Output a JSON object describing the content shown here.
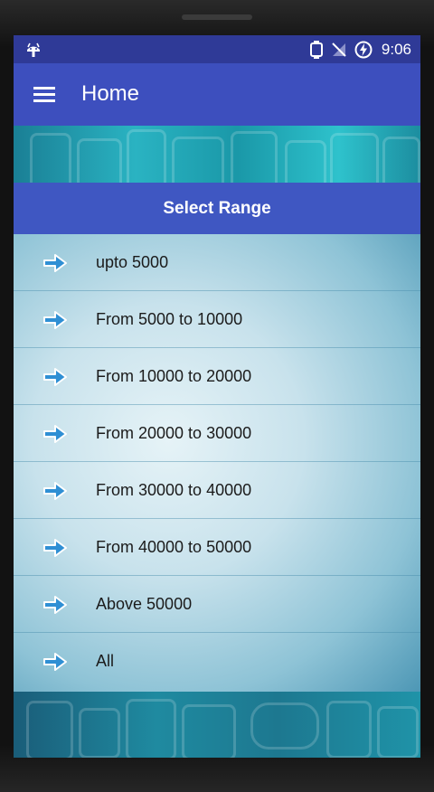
{
  "status_bar": {
    "time": "9:06",
    "icons": [
      "android-debug-icon",
      "sync-icon",
      "no-signal-icon",
      "battery-charging-icon"
    ]
  },
  "app_bar": {
    "title": "Home",
    "menu_icon": "hamburger-menu-icon"
  },
  "section": {
    "title": "Select Range"
  },
  "ranges": [
    {
      "label": "upto 5000",
      "icon": "arrow-right-icon"
    },
    {
      "label": "From 5000 to 10000",
      "icon": "arrow-right-icon"
    },
    {
      "label": "From 10000 to 20000",
      "icon": "arrow-right-icon"
    },
    {
      "label": "From 20000 to 30000",
      "icon": "arrow-right-icon"
    },
    {
      "label": "From 30000 to 40000",
      "icon": "arrow-right-icon"
    },
    {
      "label": "From 40000 to 50000",
      "icon": "arrow-right-icon"
    },
    {
      "label": "Above 50000",
      "icon": "arrow-right-icon"
    },
    {
      "label": "All",
      "icon": "arrow-right-icon"
    }
  ],
  "colors": {
    "status_bar": "#2f3a97",
    "app_bar": "#3d4fbe",
    "section_header": "#3f57c2"
  }
}
